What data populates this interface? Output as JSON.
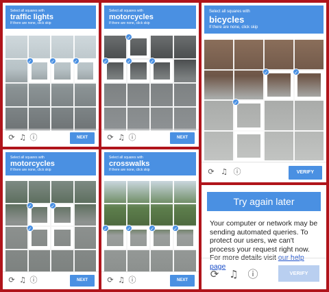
{
  "common": {
    "instruction": "Select all squares with",
    "skip_hint": "If there are none, click skip",
    "check_glyph": "✓",
    "icons": {
      "reload": "reload-icon",
      "audio": "headphones-icon",
      "info": "info-icon"
    },
    "colors": {
      "accent": "#4a90e2",
      "frame": "#b0141b"
    }
  },
  "captchas": [
    {
      "target": "traffic lights",
      "button": "NEXT"
    },
    {
      "target": "motorcycles",
      "button": "NEXT"
    },
    {
      "target": "bicycles",
      "button": "VERIFY"
    },
    {
      "target": "motorcycles",
      "button": "NEXT"
    },
    {
      "target": "crosswalks",
      "button": "NEXT"
    }
  ],
  "error_panel": {
    "title": "Try again later",
    "message": "Your computer or network may be sending automated queries. To protect our users, we can't process your request right now. For more details visit",
    "link": "our help page",
    "button": "VERIFY"
  }
}
